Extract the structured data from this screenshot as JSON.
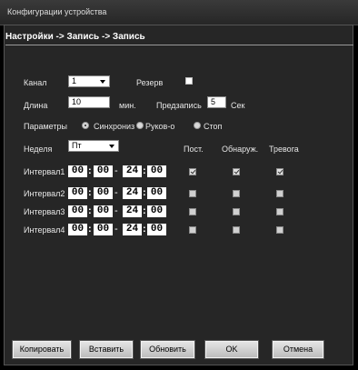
{
  "window": {
    "title": "Конфигурации устройства"
  },
  "breadcrumb": "Настройки -> Запись -> Запись",
  "form": {
    "channel_label": "Канал",
    "channel_value": "1",
    "reserve_label": "Резерв",
    "length_label": "Длина",
    "length_value": "10",
    "length_unit": "мин.",
    "prerecord_label": "Предзапись",
    "prerecord_value": "5",
    "prerecord_unit": "Сек",
    "params_label": "Параметры",
    "param_options": [
      "Синхрониз",
      "Руков-о",
      "Стоп"
    ],
    "param_selected": "Синхрониз",
    "week_label": "Неделя",
    "week_value": "Пт"
  },
  "columns": {
    "constant": "Пост.",
    "detect": "Обнаруж.",
    "alarm": "Тревога"
  },
  "intervals": [
    {
      "label": "Интервал1",
      "start_h": "00",
      "start_m": "00",
      "end_h": "24",
      "end_m": "00",
      "constant": true,
      "detect": true,
      "alarm": true
    },
    {
      "label": "Интервал2",
      "start_h": "00",
      "start_m": "00",
      "end_h": "24",
      "end_m": "00",
      "constant": false,
      "detect": false,
      "alarm": false
    },
    {
      "label": "Интервал3",
      "start_h": "00",
      "start_m": "00",
      "end_h": "24",
      "end_m": "00",
      "constant": false,
      "detect": false,
      "alarm": false
    },
    {
      "label": "Интервал4",
      "start_h": "00",
      "start_m": "00",
      "end_h": "24",
      "end_m": "00",
      "constant": false,
      "detect": false,
      "alarm": false
    }
  ],
  "buttons": {
    "copy": "Копировать",
    "paste": "Вставить",
    "refresh": "Обновить",
    "ok": "OK",
    "cancel": "Отмена"
  }
}
